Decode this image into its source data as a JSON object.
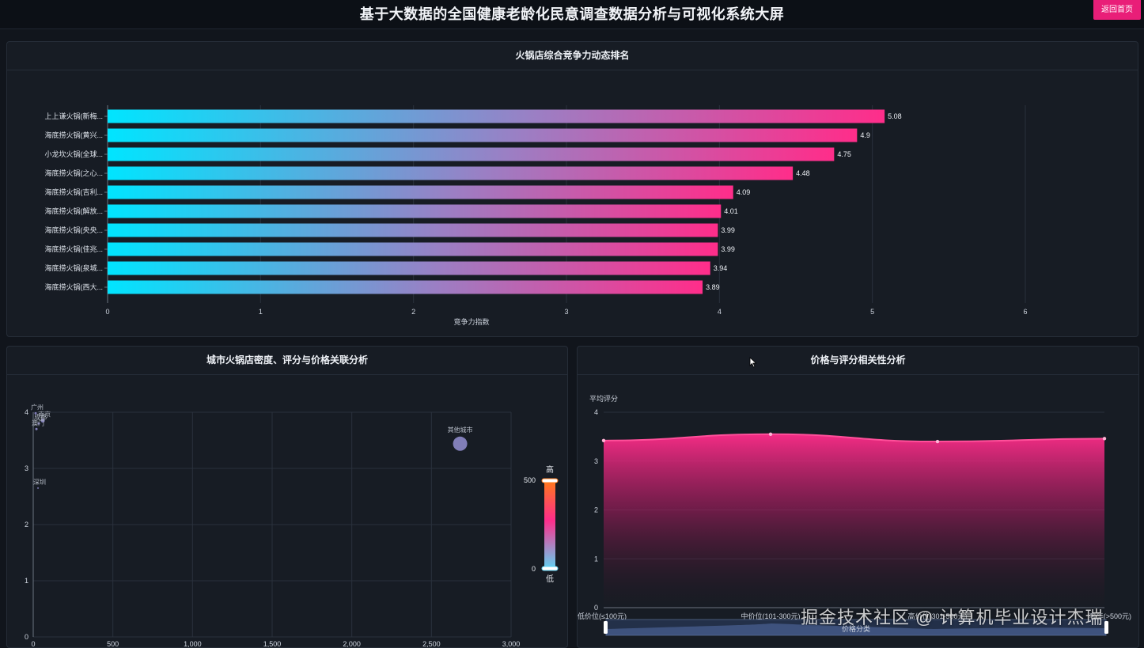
{
  "header": {
    "title": "基于大数据的全国健康老龄化民意调查数据分析与可视化系统大屏",
    "back_label": "返回首页"
  },
  "colors": {
    "accent_pink": "#ff2d8a",
    "accent_cyan": "#00e5ff",
    "background": "#11151c",
    "panel": "#171c24"
  },
  "watermark": "掘金技术社区 @ 计算机毕业设计杰瑞",
  "chart_data": [
    {
      "type": "bar",
      "orientation": "horizontal",
      "title": "火锅店综合竞争力动态排名",
      "categories": [
        "上上谦火锅(新梅...",
        "海底捞火锅(黄兴...",
        "小龙坎火锅(全球...",
        "海底捞火锅(之心...",
        "海底捞火锅(吉利...",
        "海底捞火锅(解放...",
        "海底捞火锅(央央...",
        "海底捞火锅(佳兆...",
        "海底捞火锅(泉城...",
        "海底捞火锅(西大..."
      ],
      "values": [
        5.08,
        4.9,
        4.75,
        4.48,
        4.09,
        4.01,
        3.99,
        3.99,
        3.94,
        3.89
      ],
      "value_labels": [
        "5.08",
        "4.9",
        "4.75",
        "4.48",
        "4.09",
        "4.01",
        "3.99",
        "3.99",
        "3.94",
        "3.89"
      ],
      "xlabel": "竞争力指数",
      "xlim": [
        0,
        6
      ],
      "xticks": [
        "0",
        "1",
        "2",
        "3",
        "4",
        "5",
        "6"
      ],
      "grid": true,
      "colors": [
        "#00e5ff",
        "#ff2d8a"
      ]
    },
    {
      "type": "scatter",
      "title": "城市火锅店密度、评分与价格关联分析",
      "xlim": [
        0,
        3000
      ],
      "ylim": [
        0,
        4
      ],
      "xticks": [
        "0",
        "500",
        "1,000",
        "1,500",
        "2,000",
        "2,500",
        "3,000"
      ],
      "yticks": [
        "0",
        "1",
        "2",
        "3",
        "4"
      ],
      "points": [
        {
          "label": "广州",
          "x": 15,
          "y": 3.98,
          "size": 3
        },
        {
          "label": "南京",
          "x": 60,
          "y": 3.85,
          "size": 5
        },
        {
          "label": "成都",
          "x": 35,
          "y": 3.8,
          "size": 3
        },
        {
          "label": "澳门",
          "x": 20,
          "y": 3.7,
          "size": 3
        },
        {
          "label": "深圳",
          "x": 30,
          "y": 2.65,
          "size": 2
        },
        {
          "label": "其他城市",
          "x": 2680,
          "y": 3.44,
          "size": 18
        }
      ],
      "visual_map": {
        "min": "0",
        "max": "500",
        "high_label": "高",
        "low_label": "低",
        "colors": [
          "#5fd3f3",
          "#ff2d8a",
          "#ff7a1a"
        ]
      },
      "grid": true
    },
    {
      "type": "area",
      "title": "价格与评分相关性分析",
      "ylabel": "平均评分",
      "xlabel": "价格分类",
      "categories": [
        "低价位(≤100元)",
        "中价位(101-300元)",
        "高价位(301-500元)",
        "奢华(>500元)"
      ],
      "values": [
        3.42,
        3.55,
        3.4,
        3.46
      ],
      "ylim": [
        0,
        4
      ],
      "yticks": [
        "0",
        "1",
        "2",
        "3",
        "4"
      ],
      "color": "#ff2d8a",
      "grid": true,
      "datazoom": true
    }
  ]
}
